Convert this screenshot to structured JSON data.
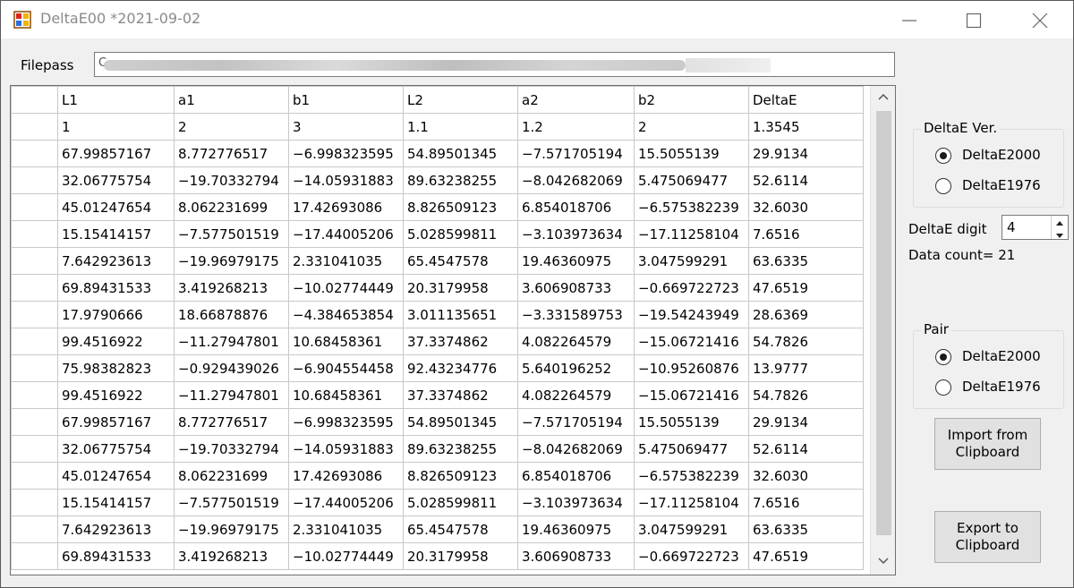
{
  "window": {
    "title": "DeltaE00  *2021-09-02",
    "icon": "app-color-icon",
    "controls": [
      "minimize-icon",
      "maximize-icon",
      "close-icon"
    ]
  },
  "filepass": {
    "label": "Filepass",
    "value": "C"
  },
  "grid": {
    "columns": [
      "L1",
      "a1",
      "b1",
      "L2",
      "a2",
      "b2",
      "DeltaE"
    ],
    "rows": [
      [
        "1",
        "2",
        "3",
        "1.1",
        "1.2",
        "2",
        "1.3545"
      ],
      [
        "67.99857167",
        "8.772776517",
        "−6.998323595",
        "54.89501345",
        "−7.571705194",
        "15.5055139",
        "29.9134"
      ],
      [
        "32.06775754",
        "−19.70332794",
        "−14.05931883",
        "89.63238255",
        "−8.042682069",
        "5.475069477",
        "52.6114"
      ],
      [
        "45.01247654",
        "8.062231699",
        "17.42693086",
        "8.826509123",
        "6.854018706",
        "−6.575382239",
        "32.6030"
      ],
      [
        "15.15414157",
        "−7.577501519",
        "−17.44005206",
        "5.028599811",
        "−3.103973634",
        "−17.11258104",
        "7.6516"
      ],
      [
        "7.642923613",
        "−19.96979175",
        "2.331041035",
        "65.4547578",
        "19.46360975",
        "3.047599291",
        "63.6335"
      ],
      [
        "69.89431533",
        "3.419268213",
        "−10.02774449",
        "20.3179958",
        "3.606908733",
        "−0.669722723",
        "47.6519"
      ],
      [
        "17.9790666",
        "18.66878876",
        "−4.384653854",
        "3.011135651",
        "−3.331589753",
        "−19.54243949",
        "28.6369"
      ],
      [
        "99.4516922",
        "−11.27947801",
        "10.68458361",
        "37.3374862",
        "4.082264579",
        "−15.06721416",
        "54.7826"
      ],
      [
        "75.98382823",
        "−0.929439026",
        "−6.904554458",
        "92.43234776",
        "5.640196252",
        "−10.95260876",
        "13.9777"
      ],
      [
        "99.4516922",
        "−11.27947801",
        "10.68458361",
        "37.3374862",
        "4.082264579",
        "−15.06721416",
        "54.7826"
      ],
      [
        "67.99857167",
        "8.772776517",
        "−6.998323595",
        "54.89501345",
        "−7.571705194",
        "15.5055139",
        "29.9134"
      ],
      [
        "32.06775754",
        "−19.70332794",
        "−14.05931883",
        "89.63238255",
        "−8.042682069",
        "5.475069477",
        "52.6114"
      ],
      [
        "45.01247654",
        "8.062231699",
        "17.42693086",
        "8.826509123",
        "6.854018706",
        "−6.575382239",
        "32.6030"
      ],
      [
        "15.15414157",
        "−7.577501519",
        "−17.44005206",
        "5.028599811",
        "−3.103973634",
        "−17.11258104",
        "7.6516"
      ],
      [
        "7.642923613",
        "−19.96979175",
        "2.331041035",
        "65.4547578",
        "19.46360975",
        "3.047599291",
        "63.6335"
      ],
      [
        "69.89431533",
        "3.419268213",
        "−10.02774449",
        "20.3179958",
        "3.606908733",
        "−0.669722723",
        "47.6519"
      ]
    ]
  },
  "deltae_ver": {
    "title": "DeltaE Ver.",
    "options": [
      "DeltaE2000",
      "DeltaE1976"
    ],
    "selected": "DeltaE2000"
  },
  "digit": {
    "label": "DeltaE digit",
    "value": "4"
  },
  "data_count": "Data count= 21",
  "pair": {
    "title": "Pair",
    "options": [
      "DeltaE2000",
      "DeltaE1976"
    ],
    "selected": "DeltaE2000"
  },
  "buttons": {
    "import": "Import from\nClipboard",
    "export": "Export to\nClipboard"
  }
}
